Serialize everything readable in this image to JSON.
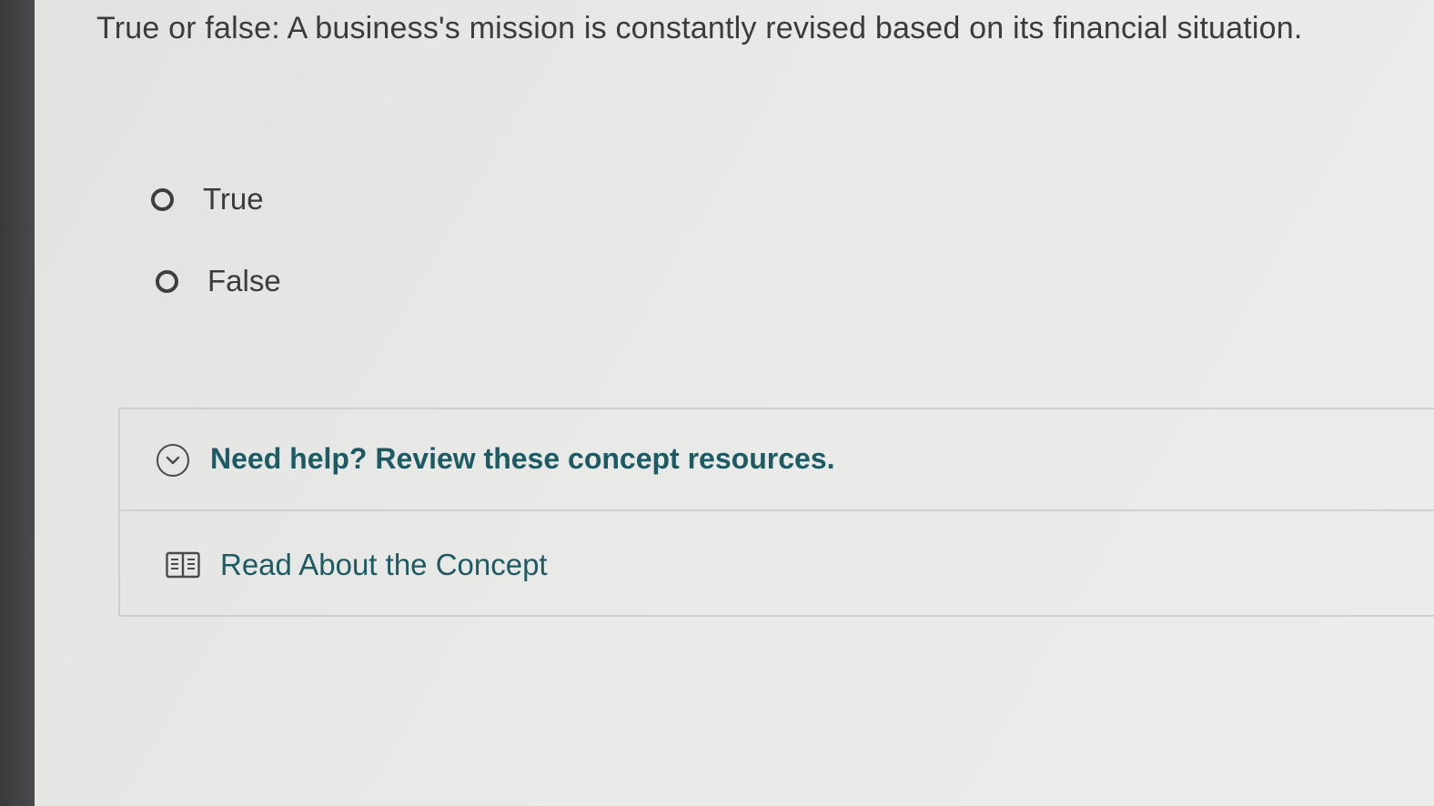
{
  "question": {
    "text": "True or false: A business's mission is constantly revised based on its financial situation."
  },
  "options": [
    {
      "label": "True",
      "selected": false
    },
    {
      "label": "False",
      "selected": false
    }
  ],
  "help": {
    "title": "Need help? Review these concept resources.",
    "expanded": true,
    "resources": [
      {
        "label": "Read About the Concept",
        "icon": "book-icon"
      }
    ]
  },
  "colors": {
    "accent": "#1d5a63",
    "text": "#3b3b3b",
    "background": "#e9e9e7"
  }
}
